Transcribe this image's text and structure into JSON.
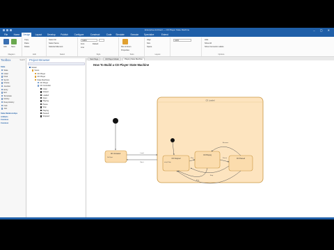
{
  "app": {
    "title": "Enterprise Architect — CD Player State Machine"
  },
  "menu": {
    "items": [
      "File",
      "Home",
      "Design",
      "Layout",
      "Develop",
      "Publish",
      "Configure",
      "Construct",
      "Code",
      "Simulate",
      "Execute",
      "Specialize",
      "Extend"
    ],
    "active_index": 2
  },
  "ribbon": {
    "groups": [
      {
        "label": "Diagram",
        "items": [
          "Add",
          "Save"
        ]
      },
      {
        "label": "Edit",
        "items": [
          "Copy",
          "Paste",
          "Delete"
        ]
      },
      {
        "label": "Select",
        "items": [
          "Select All",
          "Select Same",
          "Selected Element"
        ]
      },
      {
        "label": "Style",
        "items": [
          "Font",
          "Default",
          "Line"
        ]
      },
      {
        "label": "Tools",
        "items": [
          "Pan & Zoom",
          "Properties"
        ]
      },
      {
        "label": "Layout",
        "items": [
          "Align",
          "Size",
          "Space"
        ]
      },
      {
        "label": "Options",
        "items": [
          "Hide",
          "Show All",
          "Show Connector Labels"
        ]
      }
    ],
    "zoom": "100%",
    "font_value": "Calibri"
  },
  "tabs": [
    "Start Page",
    "CD Player Model",
    "Playing State Machine"
  ],
  "toolbox": {
    "title": "Toolbox",
    "search_label": "Search",
    "section": "State",
    "items": [
      "State",
      "Initial",
      "Final",
      "Synch",
      "Choice",
      "Junction",
      "Entry",
      "Exit",
      "Terminate",
      "History",
      "Deep History",
      "Fork",
      "Join"
    ],
    "sections_below": [
      "State Relationships",
      "Artifacts",
      "Common",
      "Common"
    ]
  },
  "browser": {
    "title": "Project Browser",
    "items": [
      {
        "label": "Model",
        "level": 0,
        "color": "#3a6fb2"
      },
      {
        "label": "Views",
        "level": 1,
        "color": "#e0a030"
      },
      {
        "label": "CD Player",
        "level": 2,
        "color": "#e0a030"
      },
      {
        "label": "CD Player",
        "level": 2,
        "color": "#e0a030"
      },
      {
        "label": "State Machines",
        "level": 2,
        "color": "#e0a030"
      },
      {
        "label": "CD Player",
        "level": 3,
        "color": "#7aa0d0"
      },
      {
        "label": "CD Controller",
        "level": 3,
        "color": "#7aa0d0"
      },
      {
        "label": "Initial",
        "level": 4,
        "color": "#333"
      },
      {
        "label": "Closed",
        "level": 4,
        "color": "#333"
      },
      {
        "label": "Loaded",
        "level": 4,
        "color": "#333"
      },
      {
        "label": "Open",
        "level": 4,
        "color": "#333"
      },
      {
        "label": "Playing",
        "level": 4,
        "color": "#333"
      },
      {
        "label": "Pause",
        "level": 4,
        "color": "#333"
      },
      {
        "label": "Stop",
        "level": 4,
        "color": "#333"
      },
      {
        "label": "Playing",
        "level": 4,
        "color": "#333"
      },
      {
        "label": "Paused",
        "level": 4,
        "color": "#333"
      },
      {
        "label": "Stopped",
        "level": 4,
        "color": "#333"
      }
    ]
  },
  "diagram": {
    "title": "How To Build a CD Player State Machine",
    "outer_state": "CD Loaded",
    "states": [
      {
        "label": "CD Unloaded",
        "sub": "Do/ Eject"
      },
      {
        "label": "CD Stopped",
        "sub": "entry/ Stop"
      },
      {
        "label": "CD Playing",
        "sub": ""
      },
      {
        "label": "CD Paused",
        "sub": ""
      }
    ],
    "transitions": [
      "Load",
      "Eject",
      "Play",
      "Pause",
      "Stop",
      "Resume",
      "Stop"
    ]
  },
  "colors": {
    "accent": "#1f5fa8",
    "state_fill": "#fbdcad",
    "state_border": "#c9953e"
  }
}
